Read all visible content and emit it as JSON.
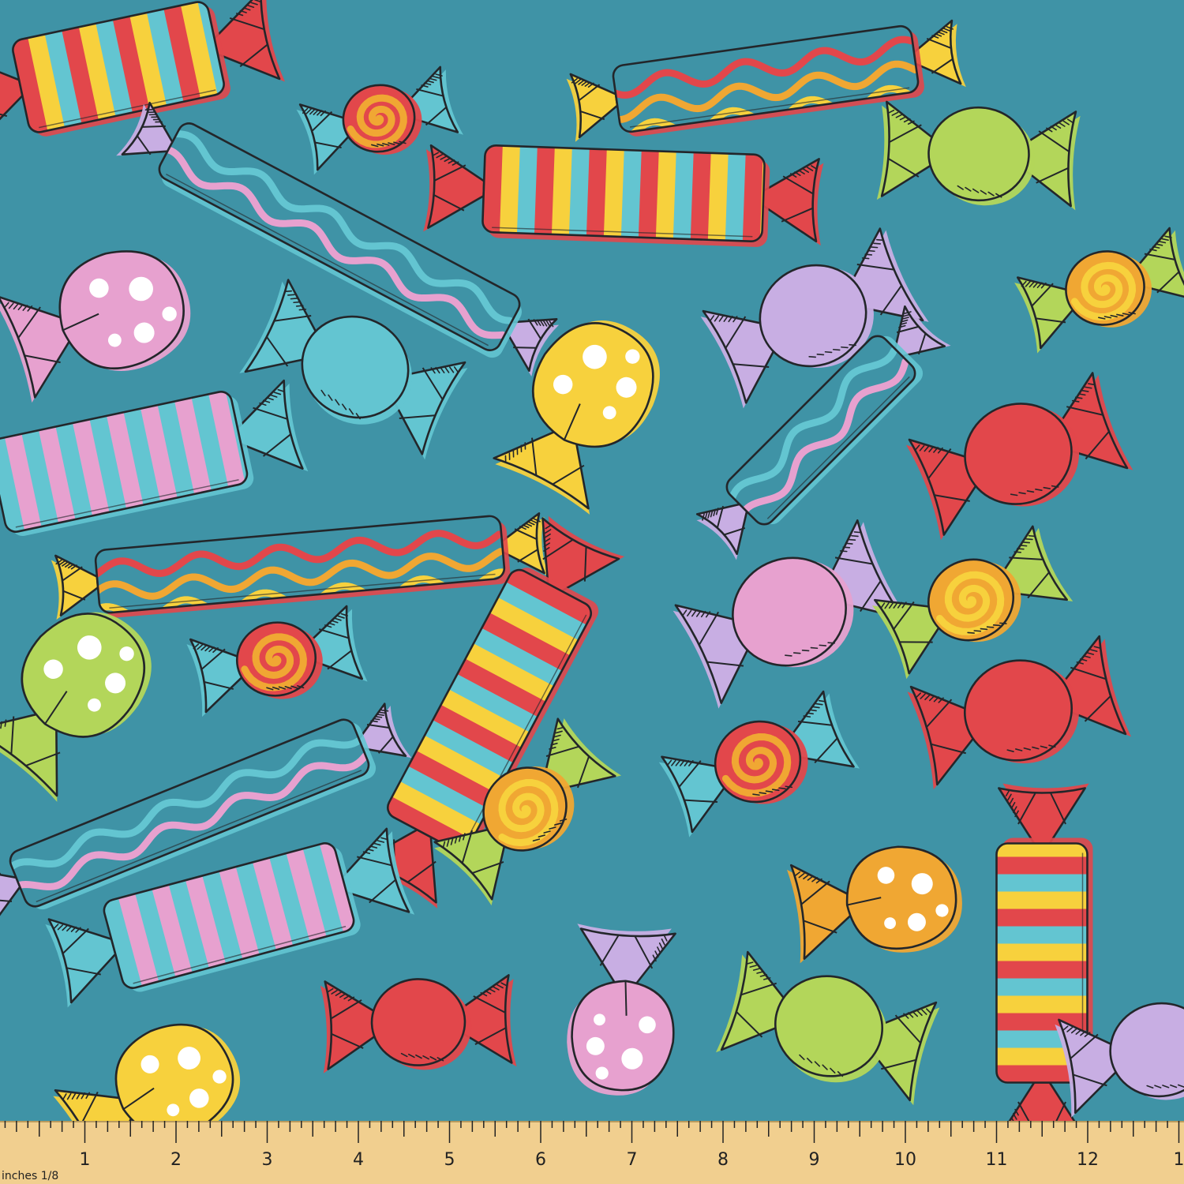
{
  "colors": {
    "background": "#3f93a6",
    "outline": "#23262a",
    "red": "#e2474b",
    "yellow": "#f7d13d",
    "orange": "#f0a733",
    "pink": "#e7a1cf",
    "lavender": "#c8aee3",
    "aqua": "#63c5d1",
    "green": "#b3d65a",
    "white": "#ffffff",
    "ruler": "#f1cf8f"
  },
  "ruler": {
    "unit_label": "inches 1/8",
    "numbers": [
      "1",
      "2",
      "3",
      "4",
      "5",
      "6",
      "7",
      "8",
      "9",
      "10",
      "11",
      "12",
      "1"
    ]
  },
  "candies": [
    {
      "kind": "bar",
      "pattern": "stripes",
      "body": [
        "red",
        "yellow",
        "aqua"
      ],
      "ends": "red"
    },
    {
      "kind": "round",
      "pattern": "swirl",
      "body": [
        "red",
        "orange"
      ],
      "ends": "aqua"
    },
    {
      "kind": "bar",
      "pattern": "wave",
      "body": [
        "red",
        "orange",
        "yellow"
      ],
      "ends": "yellow"
    },
    {
      "kind": "round",
      "pattern": "solid",
      "body": [
        "green"
      ],
      "ends": "green"
    },
    {
      "kind": "bar",
      "pattern": "stripes",
      "body": [
        "red",
        "yellow",
        "aqua"
      ],
      "ends": "red"
    },
    {
      "kind": "bar",
      "pattern": "wave",
      "body": [
        "aqua",
        "pink"
      ],
      "ends": "lavender"
    },
    {
      "kind": "drop",
      "pattern": "dots",
      "body": [
        "pink"
      ],
      "ends": "pink"
    },
    {
      "kind": "round",
      "pattern": "solid",
      "body": [
        "aqua"
      ],
      "ends": "aqua"
    },
    {
      "kind": "drop",
      "pattern": "dots",
      "body": [
        "yellow"
      ],
      "ends": "yellow"
    },
    {
      "kind": "round",
      "pattern": "solid",
      "body": [
        "lavender"
      ],
      "ends": "lavender"
    },
    {
      "kind": "round",
      "pattern": "swirl",
      "body": [
        "orange",
        "yellow"
      ],
      "ends": "green"
    },
    {
      "kind": "bar",
      "pattern": "stripes",
      "body": [
        "aqua",
        "pink"
      ],
      "ends": "aqua"
    },
    {
      "kind": "bar",
      "pattern": "wave",
      "body": [
        "aqua",
        "pink"
      ],
      "ends": "lavender"
    },
    {
      "kind": "round",
      "pattern": "solid",
      "body": [
        "red"
      ],
      "ends": "red"
    },
    {
      "kind": "bar",
      "pattern": "wave",
      "body": [
        "red",
        "orange",
        "yellow"
      ],
      "ends": "yellow"
    },
    {
      "kind": "round",
      "pattern": "swirl",
      "body": [
        "red",
        "orange"
      ],
      "ends": "aqua"
    },
    {
      "kind": "bar",
      "pattern": "stripes",
      "body": [
        "red",
        "yellow",
        "aqua"
      ],
      "ends": "red"
    },
    {
      "kind": "round",
      "pattern": "solid",
      "body": [
        "pink"
      ],
      "ends": "lavender"
    },
    {
      "kind": "round",
      "pattern": "swirl",
      "body": [
        "orange",
        "yellow"
      ],
      "ends": "green"
    },
    {
      "kind": "drop",
      "pattern": "dots",
      "body": [
        "green"
      ],
      "ends": "green"
    },
    {
      "kind": "round",
      "pattern": "swirl",
      "body": [
        "red",
        "orange"
      ],
      "ends": "aqua"
    },
    {
      "kind": "round",
      "pattern": "solid",
      "body": [
        "red"
      ],
      "ends": "red"
    },
    {
      "kind": "bar",
      "pattern": "wave",
      "body": [
        "aqua",
        "pink"
      ],
      "ends": "lavender"
    },
    {
      "kind": "round",
      "pattern": "swirl",
      "body": [
        "orange",
        "yellow"
      ],
      "ends": "green"
    },
    {
      "kind": "drop",
      "pattern": "dots",
      "body": [
        "orange"
      ],
      "ends": "orange"
    },
    {
      "kind": "bar",
      "pattern": "stripes",
      "body": [
        "aqua",
        "pink"
      ],
      "ends": "aqua"
    },
    {
      "kind": "bar",
      "pattern": "stripes",
      "body": [
        "red",
        "yellow",
        "aqua"
      ],
      "ends": "red"
    },
    {
      "kind": "round",
      "pattern": "solid",
      "body": [
        "red"
      ],
      "ends": "red"
    },
    {
      "kind": "drop",
      "pattern": "dots",
      "body": [
        "pink"
      ],
      "ends": "lavender"
    },
    {
      "kind": "round",
      "pattern": "solid",
      "body": [
        "green"
      ],
      "ends": "green"
    },
    {
      "kind": "drop",
      "pattern": "dots",
      "body": [
        "yellow"
      ],
      "ends": "yellow"
    },
    {
      "kind": "round",
      "pattern": "solid",
      "body": [
        "lavender"
      ],
      "ends": "lavender"
    }
  ]
}
